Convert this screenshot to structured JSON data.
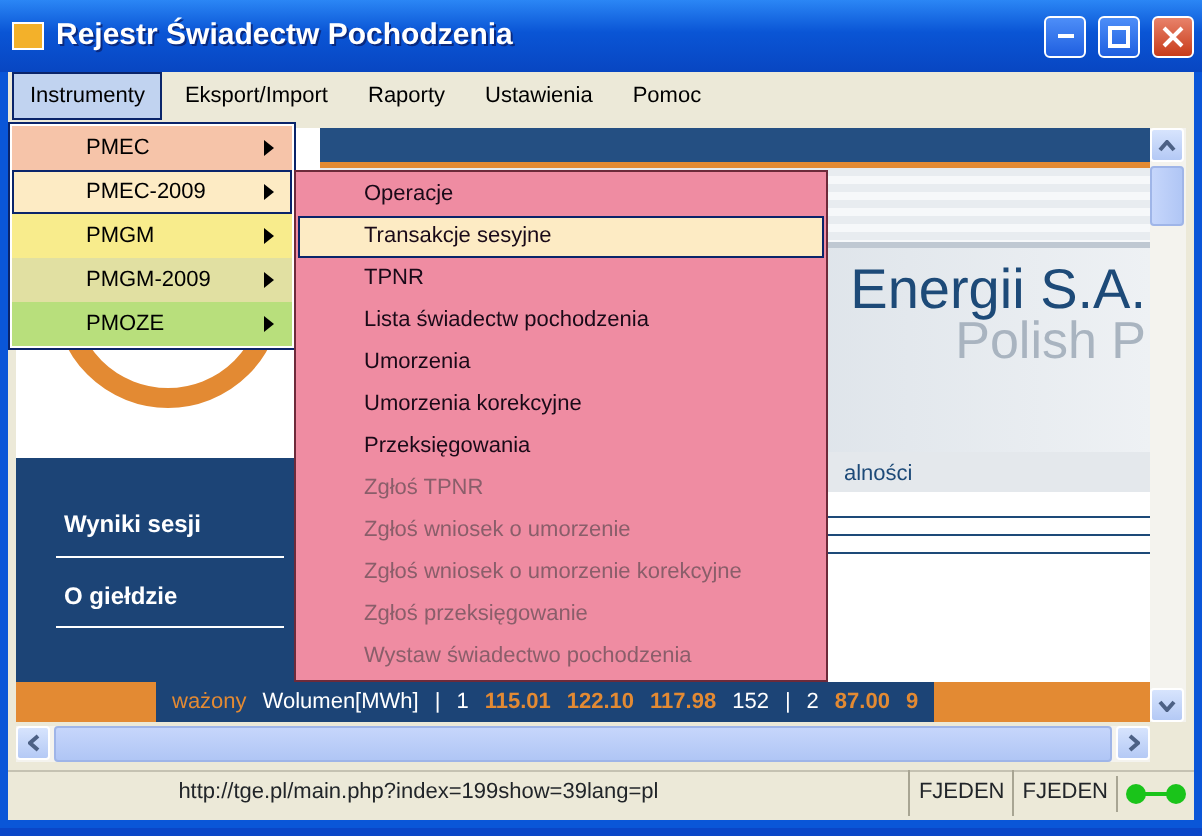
{
  "window": {
    "title": "Rejestr Świadectw Pochodzenia"
  },
  "menu_bar": [
    {
      "label": "Instrumenty",
      "selected": true
    },
    {
      "label": "Eksport/Import",
      "selected": false
    },
    {
      "label": "Raporty",
      "selected": false
    },
    {
      "label": "Ustawienia",
      "selected": false
    },
    {
      "label": "Pomoc",
      "selected": false
    }
  ],
  "instrument_menu": [
    {
      "label": "PMEC",
      "color": "#f6c4a9",
      "selected": false
    },
    {
      "label": "PMEC-2009",
      "color": "#fdebc4",
      "selected": true
    },
    {
      "label": "PMGM",
      "color": "#f8ec8c",
      "selected": false
    },
    {
      "label": "PMGM-2009",
      "color": "#e1e0a2",
      "selected": false
    },
    {
      "label": "PMOZE",
      "color": "#b8df7c",
      "selected": false
    }
  ],
  "submenu": [
    {
      "label": "Operacje",
      "disabled": false,
      "selected": false
    },
    {
      "label": "Transakcje sesyjne",
      "disabled": false,
      "selected": true
    },
    {
      "label": "TPNR",
      "disabled": false,
      "selected": false
    },
    {
      "label": "Lista świadectw pochodzenia",
      "disabled": false,
      "selected": false
    },
    {
      "label": "Umorzenia",
      "disabled": false,
      "selected": false
    },
    {
      "label": "Umorzenia korekcyjne",
      "disabled": false,
      "selected": false
    },
    {
      "label": "Przeksięgowania",
      "disabled": false,
      "selected": false
    },
    {
      "label": "Zgłoś TPNR",
      "disabled": true,
      "selected": false
    },
    {
      "label": "Zgłoś wniosek o umorzenie",
      "disabled": true,
      "selected": false
    },
    {
      "label": "Zgłoś wniosek o umorzenie korekcyjne",
      "disabled": true,
      "selected": false
    },
    {
      "label": "Zgłoś przeksięgowanie",
      "disabled": true,
      "selected": false
    },
    {
      "label": "Wystaw świadectwo pochodzenia",
      "disabled": true,
      "selected": false
    }
  ],
  "web_page": {
    "heading": "Energii S.A.",
    "subheading": "Polish P",
    "tab_text": "alności",
    "nav": [
      "Wyniki sesji",
      "O giełdzie"
    ],
    "ticker": [
      {
        "kind": "label",
        "text": "ważony"
      },
      {
        "kind": "plain",
        "text": "Wolumen[MWh]"
      },
      {
        "kind": "sep",
        "text": "|"
      },
      {
        "kind": "plain",
        "text": "1"
      },
      {
        "kind": "value",
        "text": "115.01"
      },
      {
        "kind": "value",
        "text": "122.10"
      },
      {
        "kind": "value",
        "text": "117.98"
      },
      {
        "kind": "plain",
        "text": "152"
      },
      {
        "kind": "sep",
        "text": "|"
      },
      {
        "kind": "plain",
        "text": "2"
      },
      {
        "kind": "value",
        "text": "87.00"
      },
      {
        "kind": "value",
        "text": "9"
      }
    ]
  },
  "status_bar": {
    "url": "http://tge.pl/main.php?index=199show=39lang=pl",
    "panels": [
      "FJEDEN",
      "FJEDEN"
    ],
    "connected": true
  }
}
